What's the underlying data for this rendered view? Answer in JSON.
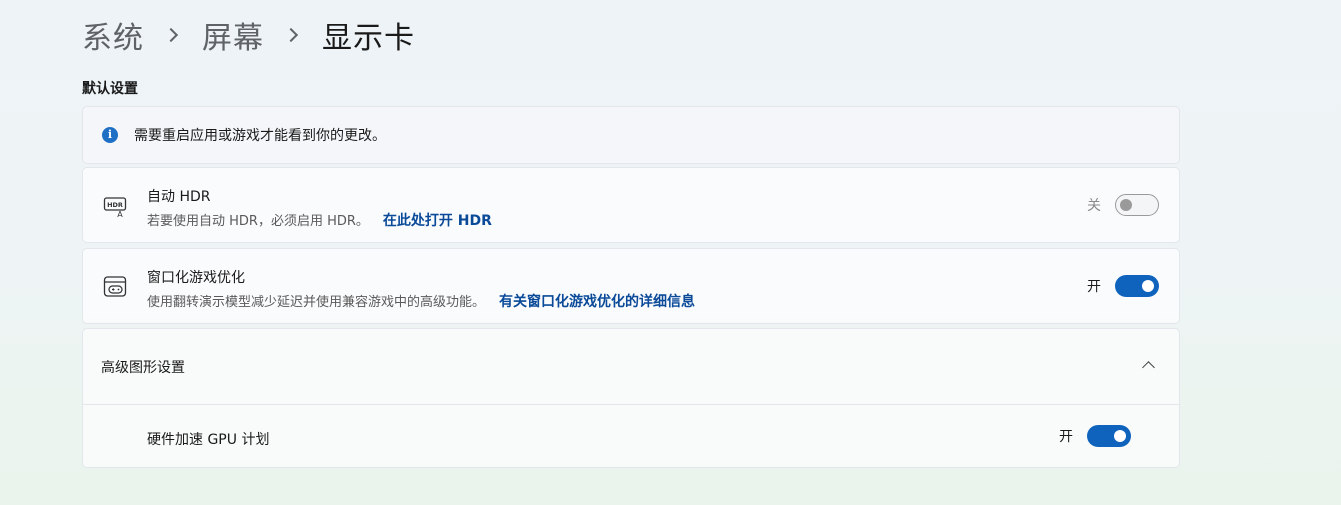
{
  "breadcrumb": {
    "items": [
      "系统",
      "屏幕",
      "显示卡"
    ]
  },
  "section": {
    "title": "默认设置"
  },
  "info": {
    "text": "需要重启应用或游戏才能看到你的更改。",
    "icon": "info-icon"
  },
  "auto_hdr": {
    "title": "自动 HDR",
    "description": "若要使用自动 HDR，必须启用 HDR。",
    "link": "在此处打开 HDR",
    "state_label": "关",
    "state": "off",
    "icon": "hdr-icon"
  },
  "windowed_optimization": {
    "title": "窗口化游戏优化",
    "description": "使用翻转演示模型减少延迟并使用兼容游戏中的高级功能。",
    "link": "有关窗口化游戏优化的详细信息",
    "state_label": "开",
    "state": "on",
    "icon": "gamepad-window-icon"
  },
  "advanced": {
    "title": "高级图形设置",
    "expanded": true,
    "gpu_scheduling": {
      "title": "硬件加速 GPU 计划",
      "state_label": "开",
      "state": "on"
    }
  },
  "colors": {
    "accent": "#0f63bd",
    "link": "#0a4a99"
  }
}
